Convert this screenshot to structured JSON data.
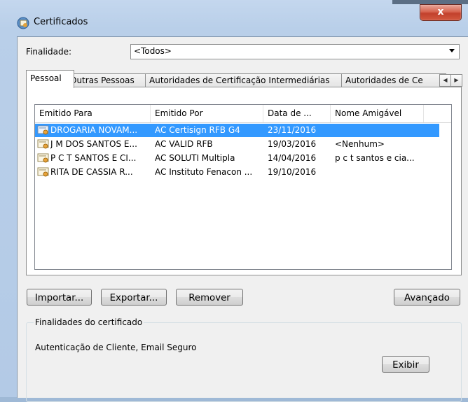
{
  "window": {
    "title": "Certificados",
    "close_label": "x"
  },
  "finalidade": {
    "label": "Finalidade:",
    "value": "<Todos>"
  },
  "tabs": [
    {
      "label": "Pessoal"
    },
    {
      "label": "Outras Pessoas"
    },
    {
      "label": "Autoridades de Certificação Intermediárias"
    },
    {
      "label": "Autoridades de Ce"
    }
  ],
  "columns": [
    "Emitido Para",
    "Emitido Por",
    "Data de ...",
    "Nome Amigável"
  ],
  "rows": [
    {
      "emitido_para": "DROGARIA NOVAM...",
      "emitido_por": "AC Certisign RFB G4",
      "data": "23/11/2016",
      "nome": "",
      "selected": true
    },
    {
      "emitido_para": "J M DOS SANTOS E...",
      "emitido_por": "AC VALID RFB",
      "data": "19/03/2016",
      "nome": "<Nenhum>"
    },
    {
      "emitido_para": "P C T SANTOS E CI...",
      "emitido_por": "AC SOLUTI Multipla",
      "data": "14/04/2016",
      "nome": "p c t santos e cia..."
    },
    {
      "emitido_para": "RITA DE CASSIA R...",
      "emitido_por": "AC Instituto Fenacon ...",
      "data": "19/10/2016",
      "nome": ""
    }
  ],
  "buttons": {
    "importar": "Importar...",
    "exportar": "Exportar...",
    "remover": "Remover",
    "avancado": "Avançado",
    "exibir": "Exibir"
  },
  "group": {
    "label": "Finalidades do certificado",
    "text": "Autenticação de Cliente, Email Seguro"
  },
  "colors": {
    "selection": "#3399ff",
    "close": "#c2412c"
  }
}
